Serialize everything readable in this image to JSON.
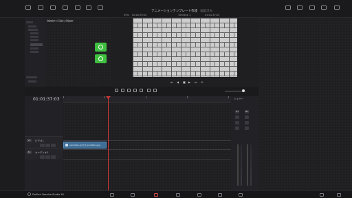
{
  "topbar": {
    "title": "アニメーションテンプレート作成",
    "edited": "編集済み",
    "tabs": [
      "",
      "",
      "",
      "",
      "",
      "",
      ""
    ]
  },
  "media_pool": {
    "path": "Master / Clips / Wipes",
    "clips": [
      {
        "color": "#3fbf3f",
        "icon": "wipe-icon"
      },
      {
        "color": "#2b6fd6",
        "icon": "wipe-icon"
      },
      {
        "color": "#2b6fd6",
        "icon": "wipe-icon"
      },
      {
        "color": "#3fbf3f",
        "icon": "wipe-icon"
      },
      {
        "color": "#3fbf3f",
        "icon": "wipe-icon"
      },
      {
        "color": "#2b6fd6",
        "icon": "wipe-icon"
      },
      {
        "color": "#2b6fd6",
        "icon": "wipe-icon"
      }
    ]
  },
  "viewer": {
    "timecode_left": "00:00:39:02",
    "timeline_name": "Timeline 1",
    "timecode_right": "01:01:37:03",
    "fps": "59%"
  },
  "timeline": {
    "current_timecode": "01:01:37:03",
    "tracks": [
      {
        "label": "ビデオ1",
        "badge": "V1"
      },
      {
        "label": "オーディオ1",
        "badge": "A1"
      }
    ],
    "clip_label": "animation-grid_B_Animation.jpg"
  },
  "mixer": {
    "title": "ミキサー",
    "channels": [
      "A1",
      "M1"
    ]
  },
  "app": {
    "name": "DaVinci Resolve Studio 18"
  }
}
